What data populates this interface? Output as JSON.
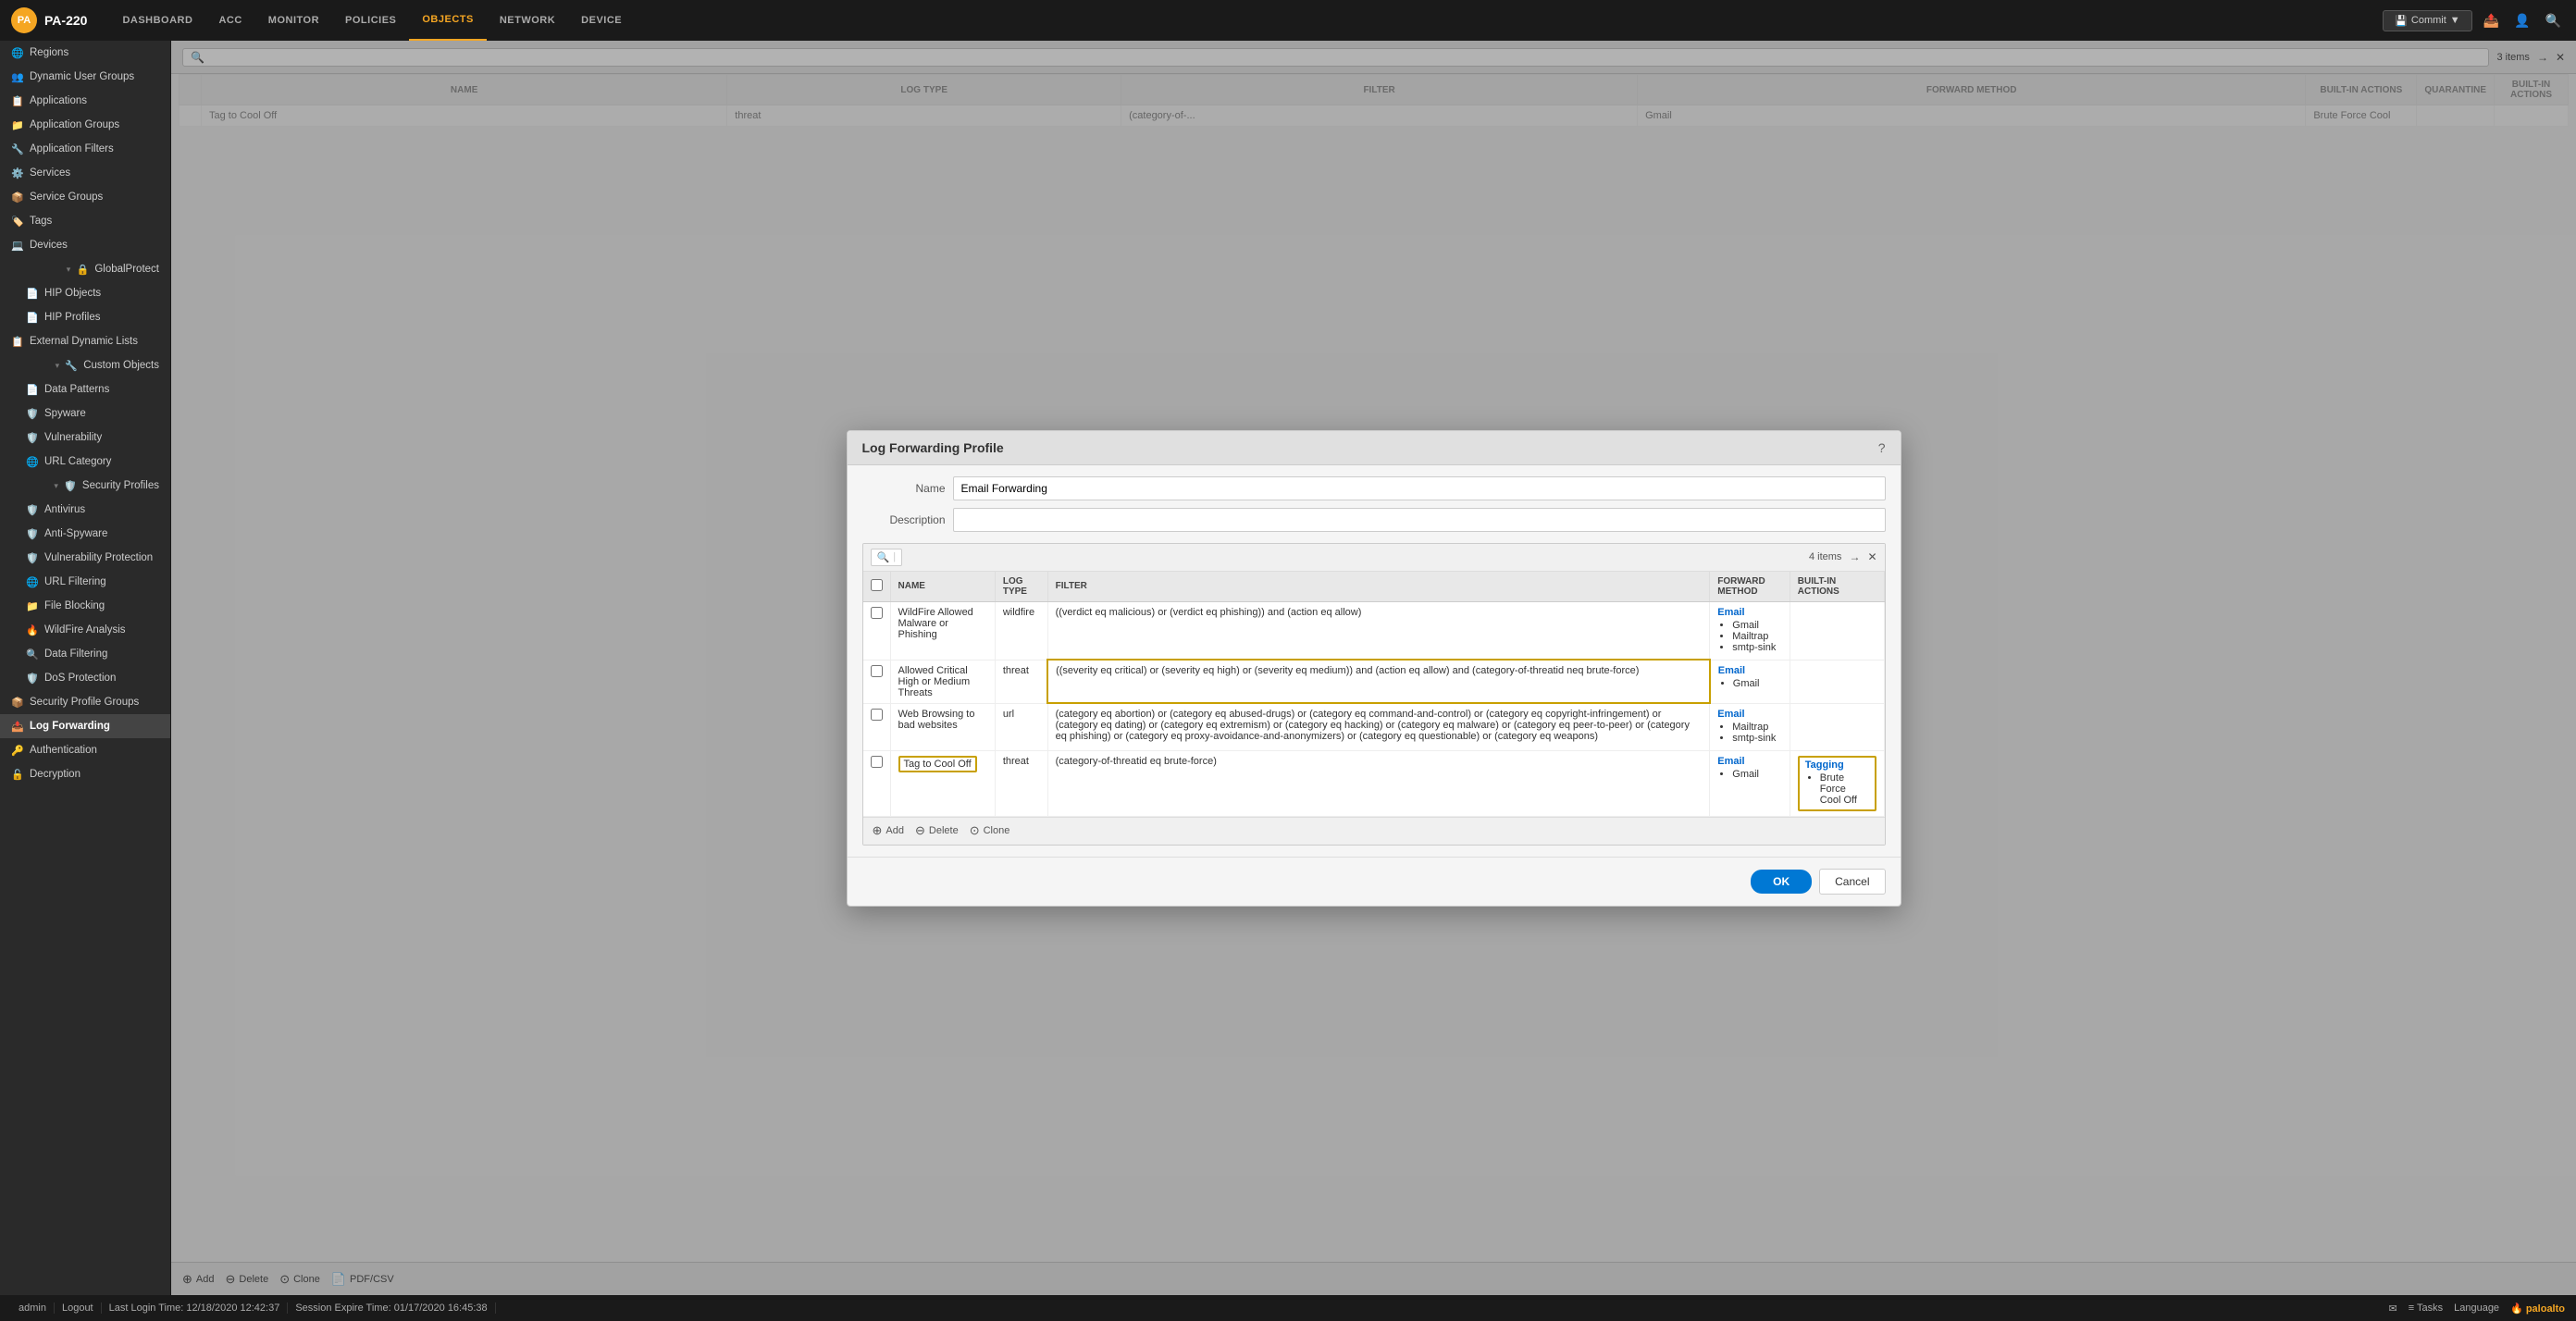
{
  "brand": {
    "logo_text": "PA",
    "device_name": "PA-220"
  },
  "nav": {
    "items": [
      "DASHBOARD",
      "ACC",
      "MONITOR",
      "POLICIES",
      "OBJECTS",
      "NETWORK",
      "DEVICE"
    ],
    "active": "OBJECTS"
  },
  "toolbar": {
    "commit_label": "Commit",
    "items_count": "3 items"
  },
  "sidebar": {
    "items": [
      {
        "label": "Regions",
        "icon": "🌐",
        "indent": false
      },
      {
        "label": "Dynamic User Groups",
        "icon": "👥",
        "indent": false
      },
      {
        "label": "Applications",
        "icon": "📋",
        "indent": false
      },
      {
        "label": "Application Groups",
        "icon": "📁",
        "indent": false
      },
      {
        "label": "Application Filters",
        "icon": "🔧",
        "indent": false
      },
      {
        "label": "Services",
        "icon": "⚙️",
        "indent": false
      },
      {
        "label": "Service Groups",
        "icon": "📦",
        "indent": false
      },
      {
        "label": "Tags",
        "icon": "🏷️",
        "indent": false
      },
      {
        "label": "Devices",
        "icon": "💻",
        "indent": false
      },
      {
        "label": "GlobalProtect",
        "icon": "🔒",
        "indent": false
      },
      {
        "label": "HIP Objects",
        "icon": "📄",
        "indent": true
      },
      {
        "label": "HIP Profiles",
        "icon": "📄",
        "indent": true
      },
      {
        "label": "External Dynamic Lists",
        "icon": "📋",
        "indent": false
      },
      {
        "label": "Custom Objects",
        "icon": "🔧",
        "indent": false
      },
      {
        "label": "Data Patterns",
        "icon": "📄",
        "indent": true
      },
      {
        "label": "Spyware",
        "icon": "🛡️",
        "indent": true
      },
      {
        "label": "Vulnerability",
        "icon": "🛡️",
        "indent": true
      },
      {
        "label": "URL Category",
        "icon": "🌐",
        "indent": true
      },
      {
        "label": "Security Profiles",
        "icon": "🛡️",
        "indent": false
      },
      {
        "label": "Antivirus",
        "icon": "🛡️",
        "indent": true
      },
      {
        "label": "Anti-Spyware",
        "icon": "🛡️",
        "indent": true
      },
      {
        "label": "Vulnerability Protection",
        "icon": "🛡️",
        "indent": true
      },
      {
        "label": "URL Filtering",
        "icon": "🌐",
        "indent": true
      },
      {
        "label": "File Blocking",
        "icon": "📁",
        "indent": true
      },
      {
        "label": "WildFire Analysis",
        "icon": "🔥",
        "indent": true
      },
      {
        "label": "Data Filtering",
        "icon": "🔍",
        "indent": true
      },
      {
        "label": "DoS Protection",
        "icon": "🛡️",
        "indent": true
      },
      {
        "label": "Security Profile Groups",
        "icon": "📦",
        "indent": false
      },
      {
        "label": "Log Forwarding",
        "icon": "📤",
        "indent": false,
        "active": true
      },
      {
        "label": "Authentication",
        "icon": "🔑",
        "indent": false
      },
      {
        "label": "Decryption",
        "icon": "🔓",
        "indent": false
      }
    ]
  },
  "modal": {
    "title": "Log Forwarding Profile",
    "name_label": "Name",
    "name_value": "Email Forwarding",
    "description_label": "Description",
    "description_value": "",
    "table": {
      "items_count": "4 items",
      "columns": [
        "NAME",
        "LOG TYPE",
        "FILTER",
        "FORWARD METHOD",
        "BUILT-IN ACTIONS"
      ],
      "rows": [
        {
          "name": "WildFire Allowed Malware or Phishing",
          "log_type": "wildfire",
          "filter": "((verdict eq malicious) or (verdict eq phishing)) and (action eq allow)",
          "forward_method_type": "Email",
          "forward_method_items": [
            "Gmail",
            "Mailtrap",
            "smtp-sink"
          ],
          "built_in_actions": [],
          "highlight_name": false,
          "highlight_filter": false,
          "highlight_built_in": false
        },
        {
          "name": "Allowed Critical High or Medium Threats",
          "log_type": "threat",
          "filter": "((severity eq critical) or (severity eq high) or (severity eq medium)) and (action eq allow) and (category-of-threatid neq brute-force)",
          "forward_method_type": "Email",
          "forward_method_items": [
            "Gmail"
          ],
          "built_in_actions": [],
          "highlight_name": false,
          "highlight_filter": true,
          "highlight_built_in": false
        },
        {
          "name": "Web Browsing to bad websites",
          "log_type": "url",
          "filter": "(category eq abortion) or (category eq abused-drugs) or (category eq command-and-control) or (category eq copyright-infringement) or (category eq dating) or (category eq extremism) or (category eq hacking) or (category eq malware) or (category eq peer-to-peer) or (category eq phishing) or (category eq proxy-avoidance-and-anonymizers) or (category eq questionable) or (category eq weapons)",
          "forward_method_type": "Email",
          "forward_method_items": [
            "Mailtrap",
            "smtp-sink"
          ],
          "built_in_actions": [],
          "highlight_name": false,
          "highlight_filter": false,
          "highlight_built_in": false
        },
        {
          "name": "Tag to Cool Off",
          "log_type": "threat",
          "filter": "(category-of-threatid eq brute-force)",
          "forward_method_type": "Email",
          "forward_method_items": [
            "Gmail"
          ],
          "built_in_actions_type": "Tagging",
          "built_in_actions_items": [
            "Brute Force Cool Off"
          ],
          "highlight_name": true,
          "highlight_filter": false,
          "highlight_built_in": true
        }
      ],
      "add_label": "Add",
      "delete_label": "Delete",
      "clone_label": "Clone"
    },
    "ok_label": "OK",
    "cancel_label": "Cancel"
  },
  "bg_table": {
    "columns": [
      "NAME",
      "LOG TYPE",
      "FILTER",
      "FORWARD METHOD",
      "BUILT-IN ACTIONS"
    ],
    "rows": [
      {
        "name": "Tag to Cool Off",
        "log_type": "threat",
        "filter": "(category-of-...",
        "forward_method": "Gmail",
        "built_in": "Brute Force Cool"
      }
    ]
  },
  "bottom_toolbar": {
    "add_label": "Add",
    "delete_label": "Delete",
    "clone_label": "Clone",
    "pdf_csv_label": "PDF/CSV"
  },
  "status_bar": {
    "admin": "admin",
    "logout": "Logout",
    "last_login": "Last Login Time: 12/18/2020 12:42:37",
    "session_expire": "Session Expire Time: 01/17/2020 16:45:38",
    "tasks": "Tasks",
    "language": "Language",
    "brand": "paloalto"
  }
}
